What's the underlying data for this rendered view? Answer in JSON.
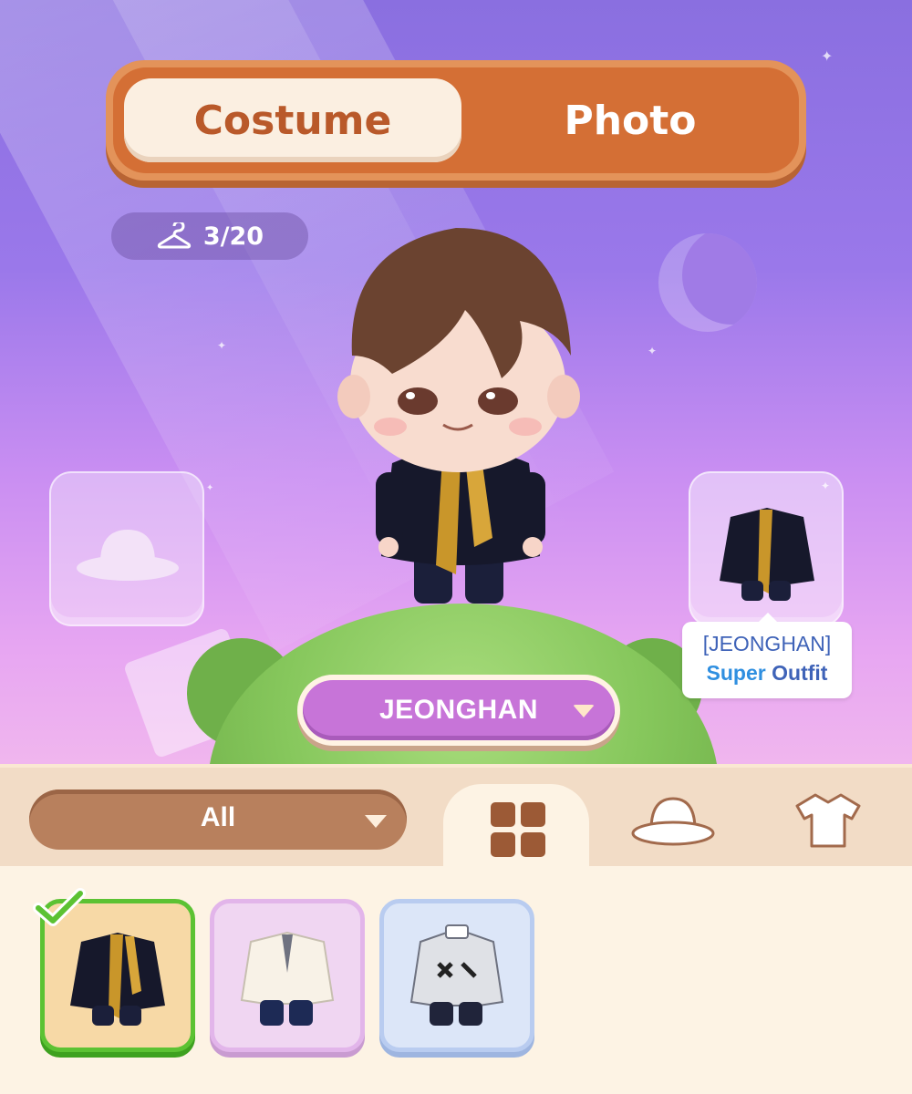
{
  "mode_toggle": {
    "costume_label": "Costume",
    "photo_label": "Photo",
    "active": "Costume"
  },
  "wardrobe_count": {
    "icon": "hanger-icon",
    "text": "3/20"
  },
  "slots": {
    "hat": {
      "icon": "hat-icon"
    },
    "outfit": {
      "icon": "outfit-icon"
    }
  },
  "outfit_tooltip": {
    "name": "[JEONGHAN]",
    "super": "Super",
    "outfit": "Outfit"
  },
  "member_select": {
    "value": "JEONGHAN",
    "icon": "chevron-down-icon"
  },
  "filter": {
    "value": "All",
    "icon": "chevron-down-icon"
  },
  "category_tabs": [
    {
      "icon": "grid-icon",
      "active": true
    },
    {
      "icon": "hat-icon",
      "active": false
    },
    {
      "icon": "shirt-icon",
      "active": false
    }
  ],
  "items": [
    {
      "name": "black-gold-outfit",
      "selected": true
    },
    {
      "name": "white-jacket-outfit",
      "selected": false
    },
    {
      "name": "gray-jacket-outfit",
      "selected": false
    }
  ],
  "colors": {
    "toggle_orange": "#d46f35",
    "member_purple": "#c774d8",
    "selected_green": "#5cc233",
    "filter_brown": "#b8805d"
  }
}
